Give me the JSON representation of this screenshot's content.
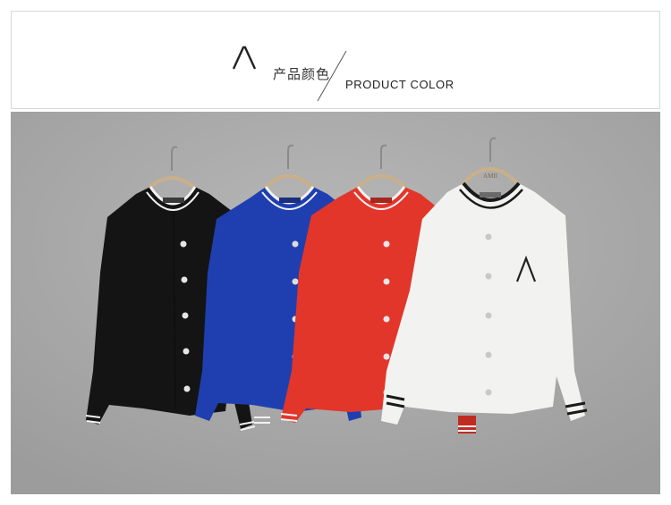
{
  "header": {
    "logo_icon": "amii-lambda-logo",
    "title_cn": "产品颜色",
    "title_en": "PRODUCT  COLOR"
  },
  "photo": {
    "hanger_brand": "AMII",
    "chest_logo_icon": "lambda-logo",
    "colors": [
      "#141414",
      "#1f3fb0",
      "#e2362b",
      "#f2f2f0"
    ]
  }
}
